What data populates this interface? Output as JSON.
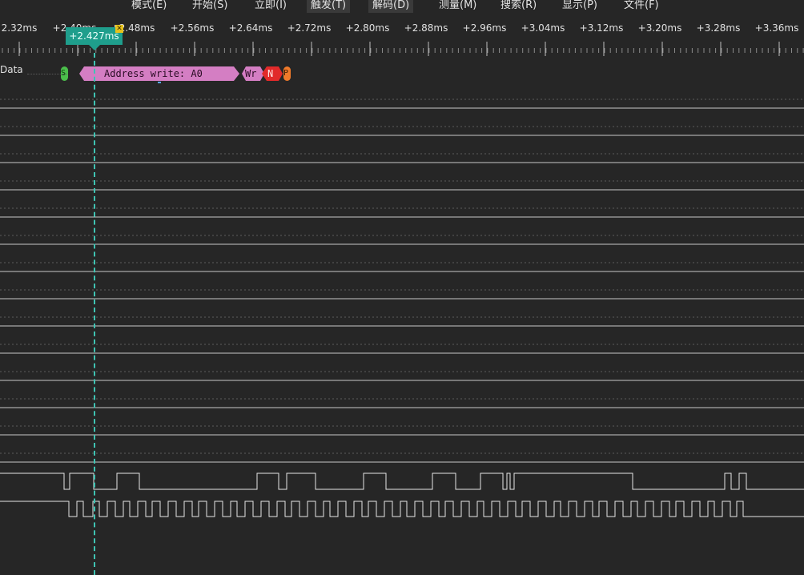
{
  "menu": [
    {
      "label": "模式(E)",
      "active": false
    },
    {
      "label": "开始(S)",
      "active": false
    },
    {
      "label": "立即(I)",
      "active": false
    },
    {
      "label": "触发(T)",
      "active": true
    },
    {
      "label": "解码(D)",
      "active": true
    },
    {
      "label": "测量(M)",
      "active": false
    },
    {
      "label": "搜索(R)",
      "active": false
    },
    {
      "label": "显示(P)",
      "active": false
    },
    {
      "label": "文件(F)",
      "active": false
    }
  ],
  "ruler": {
    "labels": [
      "2.32ms",
      "+2.40ms",
      "+2.48ms",
      "+2.56ms",
      "+2.64ms",
      "+2.72ms",
      "+2.80ms",
      "+2.88ms",
      "+2.96ms",
      "+3.04ms",
      "+3.12ms",
      "+3.20ms",
      "+3.28ms",
      "+3.36ms"
    ]
  },
  "cursor": {
    "time_label": "+2.427ms",
    "close_glyph": "✕"
  },
  "decoder": {
    "channel_label": "Data",
    "start": "S",
    "address": "Address write: A0",
    "rw": "Wr",
    "ack": "N",
    "stop": "P"
  },
  "colors": {
    "background": "#262626",
    "accent": "#1f9e8c",
    "address": "#d47ec3",
    "nack": "#e12a2a",
    "start": "#4bbf4b",
    "stop": "#f07a2a",
    "signal": "#e6e6e6"
  }
}
